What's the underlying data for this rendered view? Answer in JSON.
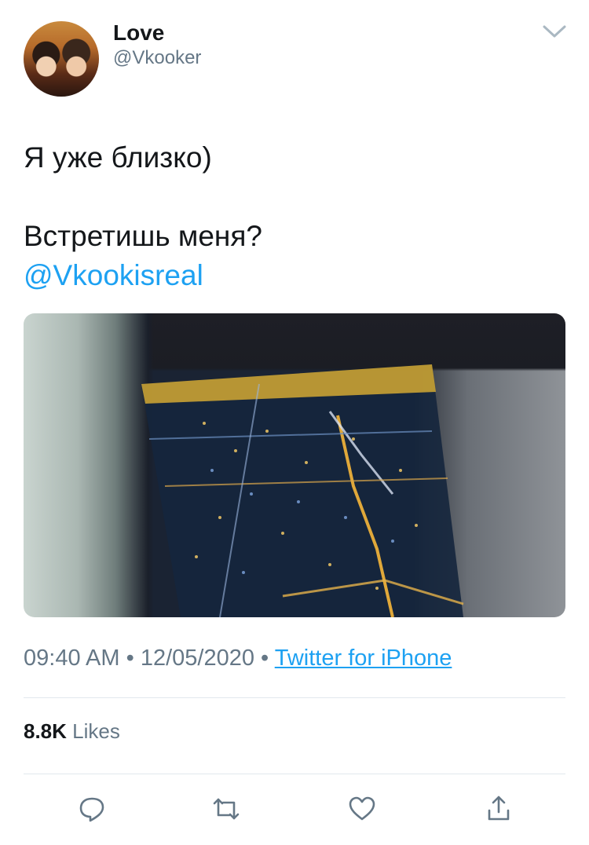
{
  "author": {
    "name": "Love",
    "handle": "@Vkooker"
  },
  "tweet": {
    "lines": [
      "Я уже близко)",
      "Встретишь меня?"
    ],
    "mention": "@Vkookisreal"
  },
  "meta": {
    "time": "09:40 AM",
    "separator": "•",
    "date": "12/05/2020",
    "source": "Twitter for iPhone"
  },
  "stats": {
    "likes_count": "8.8K",
    "likes_label": "Likes"
  },
  "actions": [
    "reply-icon",
    "retweet-icon",
    "like-icon",
    "share-icon"
  ],
  "colors": {
    "link": "#1da1f2",
    "secondary": "#657786",
    "text": "#14171a"
  }
}
